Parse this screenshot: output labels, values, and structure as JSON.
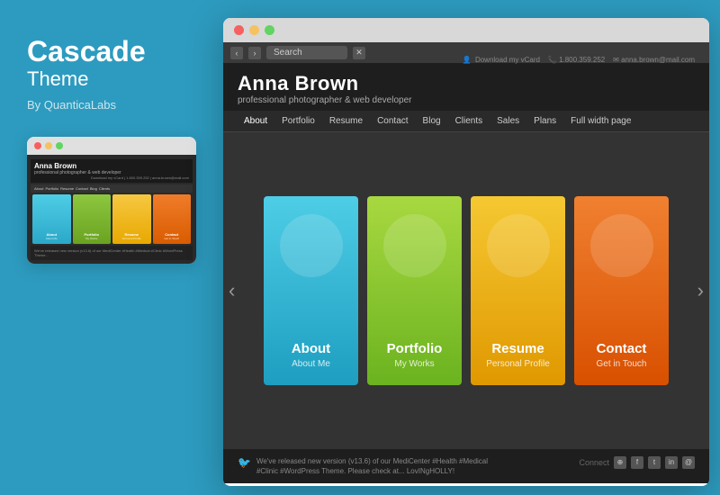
{
  "left": {
    "title": "Cascade",
    "subtitle": "Theme",
    "by": "By QuanticaLabs"
  },
  "small_preview": {
    "window_dots": [
      "red",
      "yellow",
      "green"
    ],
    "site_name": "Anna Brown",
    "nav_items": [
      "About",
      "Portfolio",
      "Resume",
      "Contact"
    ],
    "cards": [
      {
        "label": "About",
        "sub": "About Me",
        "color": "blue"
      },
      {
        "label": "Portfolio",
        "sub": "My Works",
        "color": "green"
      },
      {
        "label": "Resume",
        "sub": "Personal Profile",
        "color": "yellow"
      },
      {
        "label": "Contact",
        "sub": "Get in Touch",
        "color": "orange"
      }
    ]
  },
  "main_browser": {
    "window_dots": [
      "red",
      "yellow",
      "green"
    ],
    "address_bar": "Search",
    "site": {
      "name": "Anna Brown",
      "tagline": "professional photographer & web developer",
      "contact": "Download my vCard    1.800.359.252    anna.brown@mail.com",
      "nav": [
        "About",
        "Portfolio",
        "Resume",
        "Contact",
        "Blog",
        "Clients",
        "Sales",
        "Plans",
        "Full width page"
      ],
      "hero_cards": [
        {
          "title": "About",
          "subtitle": "About Me",
          "color": "blue"
        },
        {
          "title": "Portfolio",
          "subtitle": "My Works",
          "color": "green"
        },
        {
          "title": "Resume",
          "subtitle": "Personal Profile",
          "color": "yellow"
        },
        {
          "title": "Contact",
          "subtitle": "Get in Touch",
          "color": "orange"
        }
      ],
      "footer_text": "We've released new version (v13.6) of our MediCenter #Health #Medical #Clinic #WordPress Theme. Please check at... LovINgHOLLY!",
      "connect_label": "Connect"
    }
  }
}
